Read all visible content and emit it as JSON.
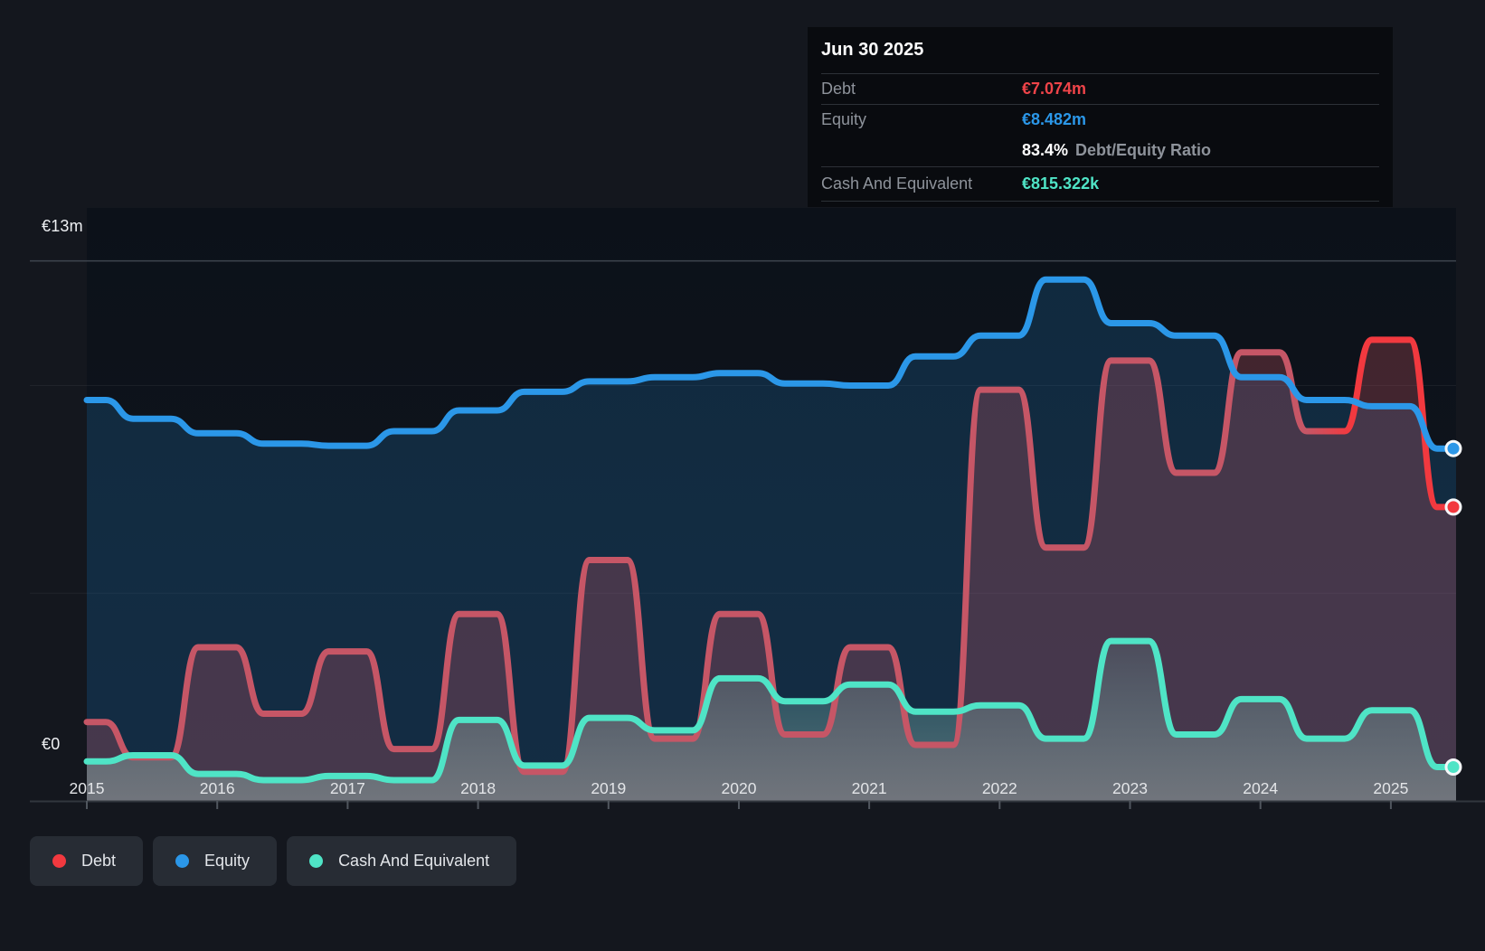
{
  "tooltip": {
    "date": "Jun 30 2025",
    "debt_label": "Debt",
    "debt_value": "€7.074m",
    "debt_color": "#ef4449",
    "equity_label": "Equity",
    "equity_value": "€8.482m",
    "equity_color": "#2b97e8",
    "ratio_value": "83.4%",
    "ratio_label": "Debt/Equity Ratio",
    "cash_label": "Cash And Equivalent",
    "cash_value": "€815.322k",
    "cash_color": "#4fe4c6"
  },
  "legend": {
    "debt": "Debt",
    "equity": "Equity",
    "cash": "Cash And Equivalent"
  },
  "y_axis": {
    "top_label": "€13m",
    "bottom_label": "€0"
  },
  "x_axis": {
    "years": [
      "2015",
      "2016",
      "2017",
      "2018",
      "2019",
      "2020",
      "2021",
      "2022",
      "2023",
      "2024",
      "2025"
    ]
  },
  "chart_data": {
    "type": "area",
    "title": "Debt to Equity history (EUR millions)",
    "x_unit": "calendar year (x.0 = Dec 31 of prior year, x.5 = Jun 30)",
    "x": [
      2015,
      2015.5,
      2016,
      2016.5,
      2017,
      2017.5,
      2018,
      2018.5,
      2019,
      2019.5,
      2020,
      2020.5,
      2021,
      2021.5,
      2022,
      2022.5,
      2023,
      2023.5,
      2024,
      2024.5,
      2025,
      2025.5
    ],
    "series": [
      {
        "name": "Debt",
        "color": "#c65666",
        "color_recent": "#f2393f",
        "fill": "rgba(205,85,102,0.28)",
        "values": [
          1.9,
          1.05,
          3.7,
          2.1,
          3.6,
          1.25,
          4.5,
          0.7,
          5.8,
          1.5,
          4.5,
          1.6,
          3.7,
          1.35,
          9.9,
          6.1,
          10.6,
          7.9,
          10.8,
          8.9,
          11.1,
          7.074
        ]
      },
      {
        "name": "Equity",
        "color": "#2b97e8",
        "fill": "rgba(36,142,214,0.20)",
        "values": [
          9.65,
          9.2,
          8.85,
          8.6,
          8.55,
          8.9,
          9.4,
          9.85,
          10.1,
          10.2,
          10.3,
          10.05,
          10.0,
          10.7,
          11.2,
          12.55,
          11.5,
          11.2,
          10.2,
          9.65,
          9.5,
          8.482
        ]
      },
      {
        "name": "Cash And Equivalent",
        "color": "#4fe4c6",
        "fill_top": "rgba(110,205,190,0.10)",
        "fill_bottom": "rgba(152,172,168,0.52)",
        "values": [
          0.95,
          1.1,
          0.65,
          0.5,
          0.6,
          0.5,
          1.95,
          0.85,
          2.0,
          1.7,
          2.95,
          2.4,
          2.8,
          2.15,
          2.3,
          1.5,
          3.85,
          1.6,
          2.45,
          1.5,
          2.18,
          0.815
        ]
      }
    ],
    "ylim": [
      0,
      13
    ],
    "gridline_values": [
      13,
      10,
      5
    ],
    "grid": true,
    "legend_position": "bottom-left",
    "latest_point": {
      "date": "Jun 30 2025",
      "debt": 7.074,
      "equity": 8.482,
      "debt_equity_ratio_pct": 83.4,
      "cash_and_equivalent": 0.815322
    }
  }
}
